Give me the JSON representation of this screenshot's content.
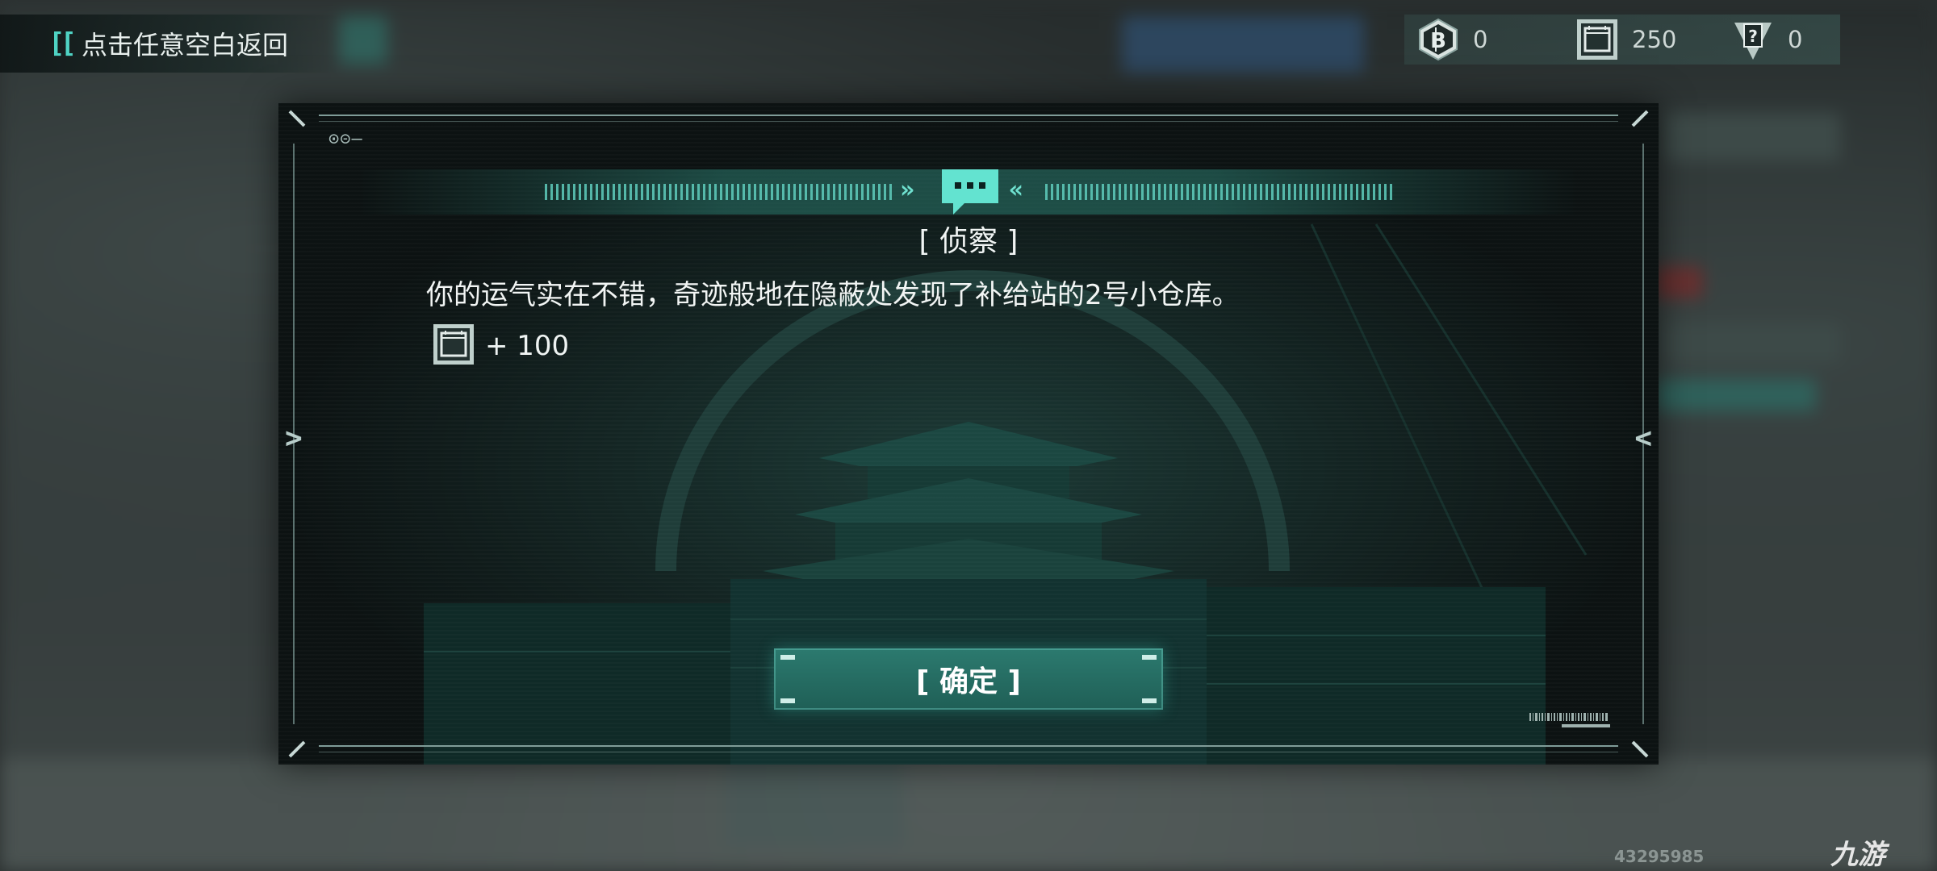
{
  "hud": {
    "back_hint": "点击任意空白返回",
    "currencies": [
      {
        "icon": "b-coin-icon",
        "value": "0"
      },
      {
        "icon": "supply-crate-icon",
        "value": "250"
      },
      {
        "icon": "mystery-card-icon",
        "value": "0"
      }
    ]
  },
  "dialog": {
    "title": "[ 侦察 ]",
    "message": "你的运气实在不错，奇迹般地在隐蔽处发现了补给站的2号小仓库。",
    "reward": {
      "icon": "supply-crate-icon",
      "amount": "+ 100"
    },
    "confirm_label": "[ 确定 ]"
  },
  "watermark": {
    "id": "43295985",
    "logo": "九游"
  },
  "colors": {
    "accent": "#4fd3c4",
    "button": "#2c7a6f",
    "panel": "#0c1212"
  }
}
